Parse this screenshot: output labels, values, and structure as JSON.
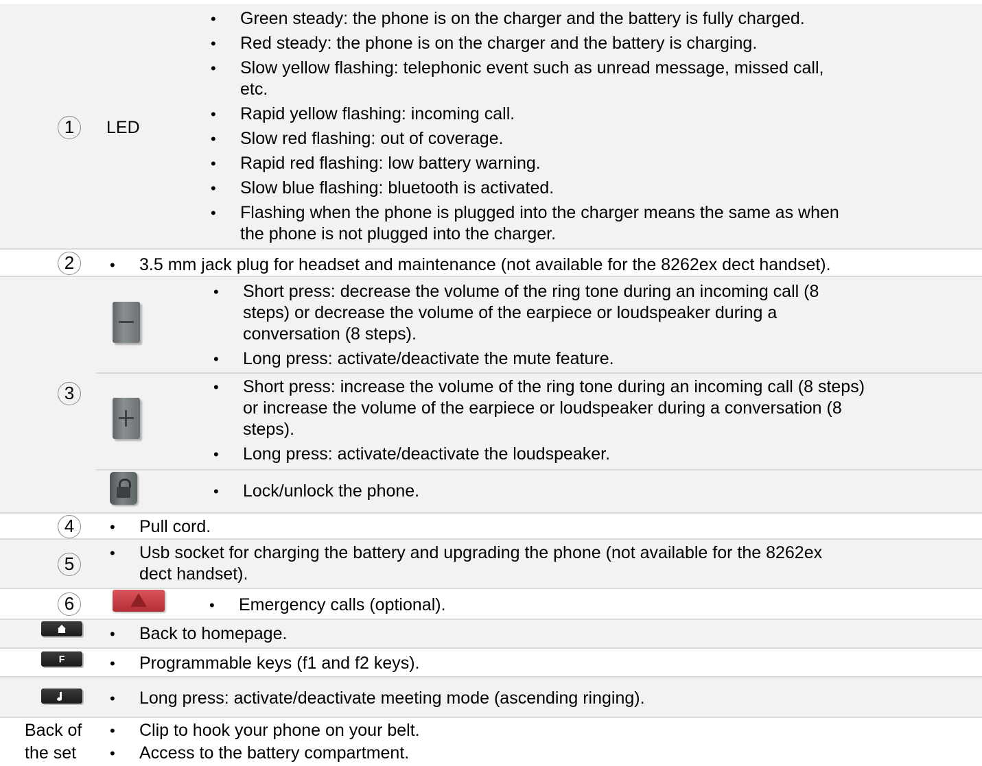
{
  "rows": {
    "r1": {
      "number": "1",
      "label": "LED",
      "items": [
        "Green steady: the phone is on the charger and the battery is fully charged.",
        "Red steady: the phone is on the charger and the battery is charging.",
        "Slow yellow flashing: telephonic event such as unread message, missed call,",
        "etc.",
        "Rapid yellow flashing: incoming call.",
        "Slow red flashing: out of coverage.",
        "Rapid red flashing: low battery warning.",
        "Slow blue flashing: bluetooth is activated.",
        "Flashing when the phone is plugged into the charger means the same as when",
        "the phone is not plugged into the charger."
      ]
    },
    "r2": {
      "number": "2",
      "text": "3.5 mm jack plug for headset and maintenance (not available for the 8262ex dect handset)."
    },
    "r3": {
      "number": "3",
      "minus": [
        "Short press: decrease the volume of the ring tone during an incoming call (8",
        "steps) or decrease the volume of the earpiece or loudspeaker during a",
        "conversation (8 steps).",
        "Long press: activate/deactivate the mute feature."
      ],
      "plus": [
        "Short press: increase the volume of the ring tone during an incoming call (8 steps)",
        "or increase the volume of the earpiece or loudspeaker during a conversation (8",
        "steps).",
        "Long press: activate/deactivate the loudspeaker."
      ],
      "lock": "Lock/unlock the phone.",
      "icons": {
        "minus": "volume-down-key-icon",
        "plus": "volume-up-key-icon",
        "lock": "lock-key-icon"
      }
    },
    "r4": {
      "number": "4",
      "text": "Pull cord."
    },
    "r5": {
      "number": "5",
      "lines": [
        "Usb socket for charging the battery and upgrading the phone (not available for the 8262ex",
        "dect handset)."
      ]
    },
    "r6": {
      "number": "6",
      "text": "Emergency calls (optional).",
      "icon": "emergency-key-icon"
    },
    "home": {
      "text": "Back to homepage.",
      "icon": "home-key-icon"
    },
    "fkey": {
      "key_label": "F",
      "text": "Programmable keys (f1 and f2 keys).",
      "icon": "f-key-icon"
    },
    "meeting": {
      "text": "Long press: activate/deactivate meeting mode (ascending ringing).",
      "icon": "meeting-key-icon"
    },
    "back": {
      "label_line1": "Back of",
      "label_line2": "the set",
      "items": [
        "Clip to hook your phone on your belt.",
        "Access to the battery compartment."
      ]
    }
  },
  "colors": {
    "shade": "#f2f2f2",
    "separator": "#d9d9d9",
    "emergency": "#c0393b"
  }
}
